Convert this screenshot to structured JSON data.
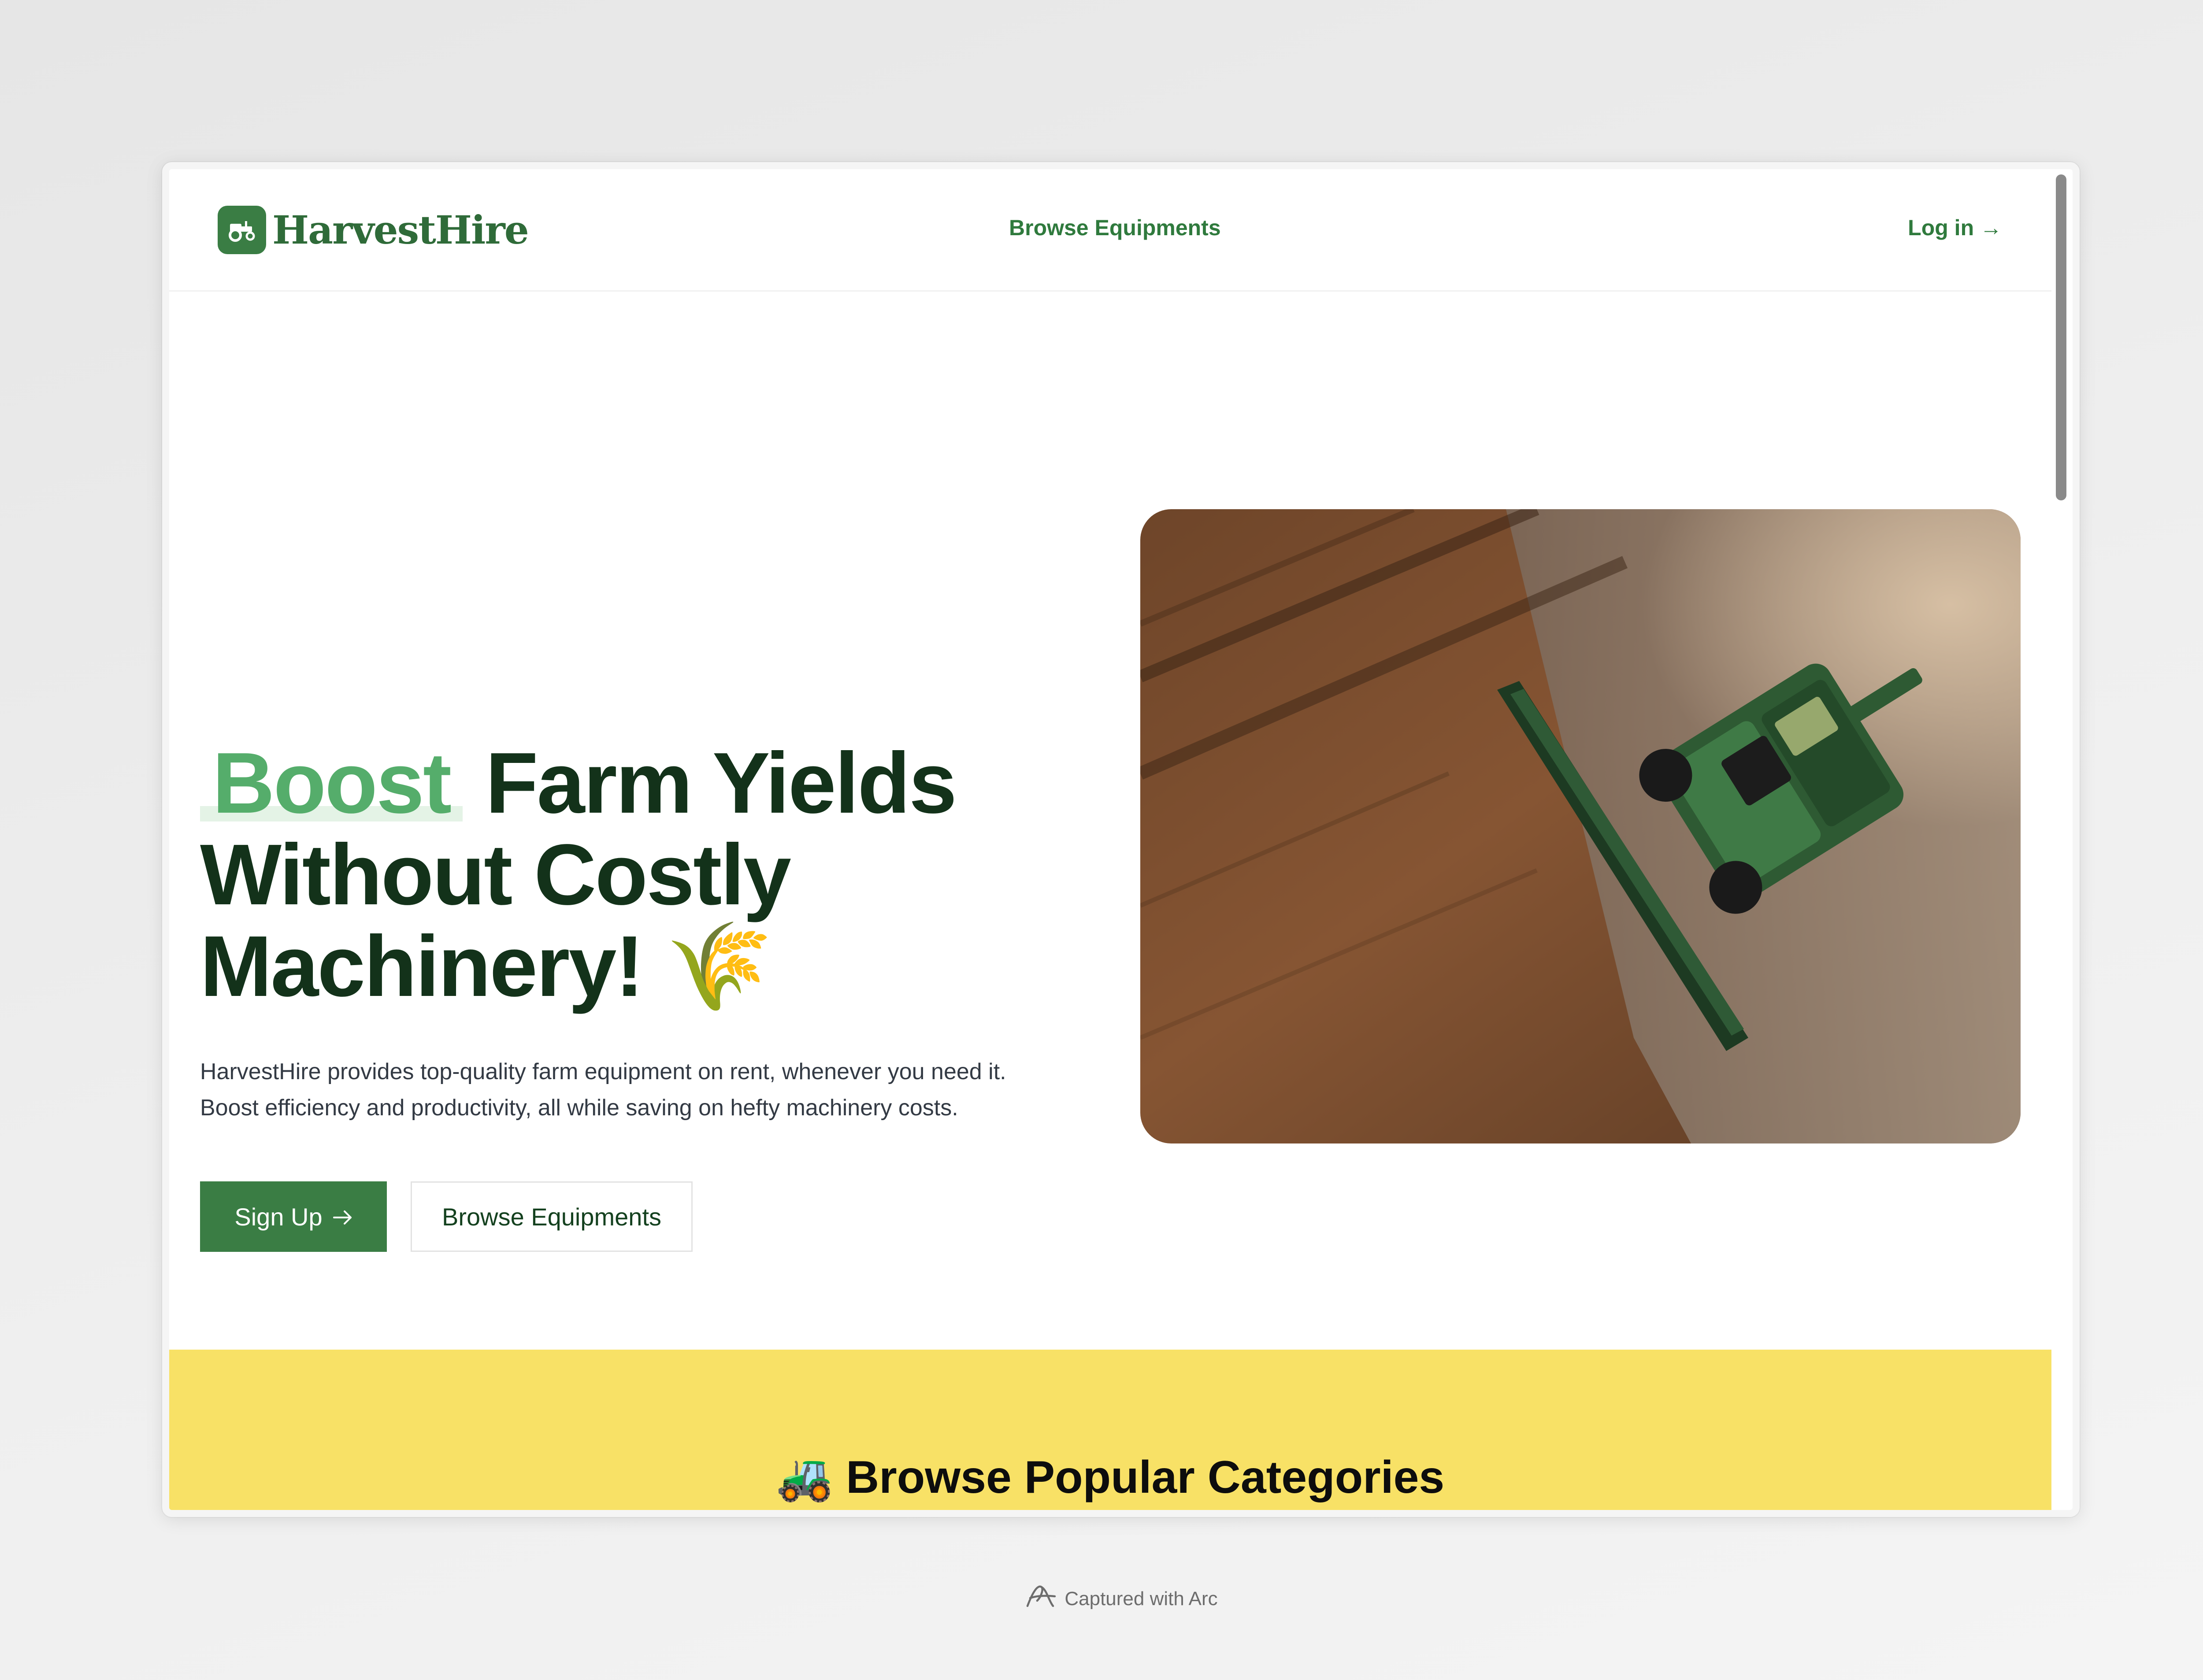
{
  "brand": {
    "name": "HarvestHire",
    "logo_icon": "tractor-icon",
    "accent_color": "#3a7d44"
  },
  "nav": {
    "center_link": "Browse Equipments",
    "login_label": "Log in →"
  },
  "hero": {
    "title_highlight": "Boost",
    "title_rest_line1": " Farm Yields",
    "title_line2": "Without Costly",
    "title_line3": "Machinery!",
    "title_emoji": "🌾",
    "description_line1": "HarvestHire provides top-quality farm equipment on rent, whenever you need it.",
    "description_line2": "Boost efficiency and productivity, all while saving on hefty machinery costs.",
    "primary_button": "Sign Up",
    "primary_button_icon": "arrow-right-icon",
    "secondary_button": "Browse Equipments",
    "image_subject": "combine-harvester-aerial-photo"
  },
  "categories": {
    "emoji": "🚜",
    "title": "Browse Popular Categories",
    "band_color": "#f8e166"
  },
  "capture": {
    "label": "Captured with Arc"
  }
}
